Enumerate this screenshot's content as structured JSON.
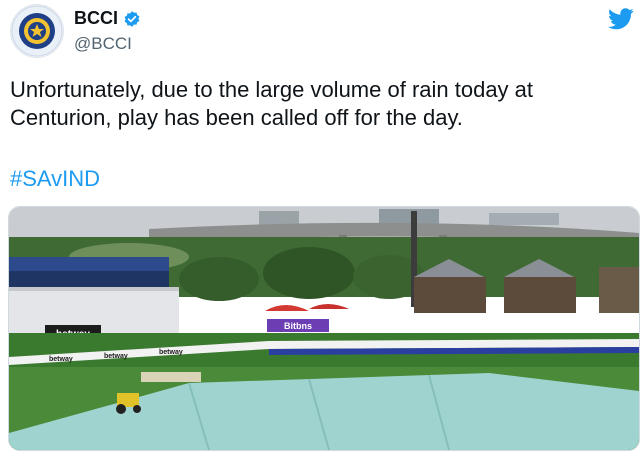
{
  "account": {
    "display_name": "BCCI",
    "handle": "@BCCI",
    "verified_icon": "verified-badge-icon",
    "avatar_icon": "bcci-logo-icon"
  },
  "platform_icon": "twitter-bird-icon",
  "tweet": {
    "text": "Unfortunately, due to the large volume of rain today at Centurion, play has been called off for the day.",
    "hashtag": "#SAvIND"
  },
  "media": {
    "description_icon": "stadium-photo",
    "board_labels": [
      "betway",
      "Bitbns",
      "betway",
      "betway",
      "betway",
      "betway"
    ]
  },
  "colors": {
    "link": "#1d9bf0",
    "text": "#0f1419",
    "secondary": "#536471"
  }
}
